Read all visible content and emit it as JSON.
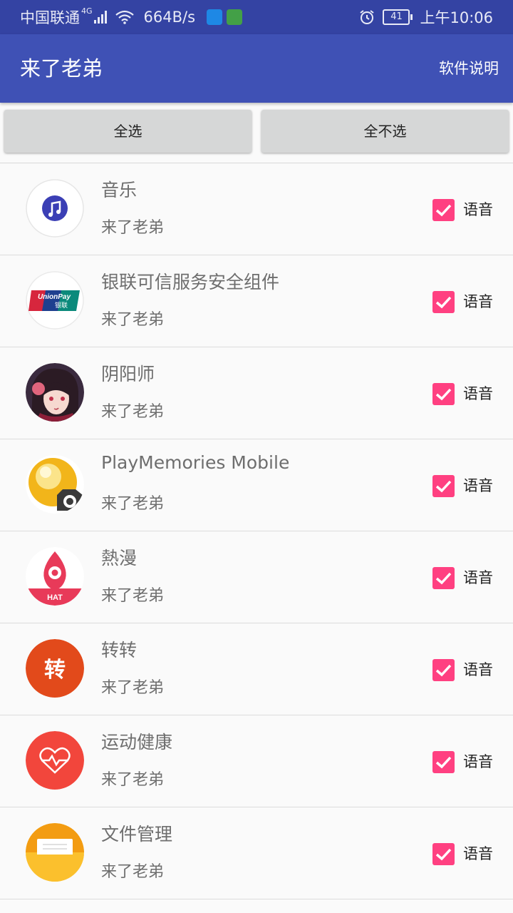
{
  "status_bar": {
    "carrier": "中国联通",
    "network": "4G",
    "speed": "664B/s",
    "battery": "41",
    "time": "上午10:06"
  },
  "app_bar": {
    "title": "来了老弟",
    "action": "软件说明"
  },
  "buttons": {
    "select_all": "全选",
    "select_none": "全不选"
  },
  "items": [
    {
      "name": "音乐",
      "subtitle": "来了老弟",
      "checked": true,
      "check_label": "语音",
      "icon": "music-app-icon"
    },
    {
      "name": "银联可信服务安全组件",
      "subtitle": "来了老弟",
      "checked": true,
      "check_label": "语音",
      "icon": "unionpay-app-icon"
    },
    {
      "name": "阴阳师",
      "subtitle": "来了老弟",
      "checked": true,
      "check_label": "语音",
      "icon": "onmyoji-app-icon"
    },
    {
      "name": "PlayMemories Mobile",
      "subtitle": "来了老弟",
      "checked": true,
      "check_label": "语音",
      "icon": "playmemories-app-icon"
    },
    {
      "name": "熱漫",
      "subtitle": "来了老弟",
      "checked": true,
      "check_label": "语音",
      "icon": "reman-app-icon"
    },
    {
      "name": "转转",
      "subtitle": "来了老弟",
      "checked": true,
      "check_label": "语音",
      "icon": "zhuanzhuan-app-icon"
    },
    {
      "name": "运动健康",
      "subtitle": "来了老弟",
      "checked": true,
      "check_label": "语音",
      "icon": "health-app-icon"
    },
    {
      "name": "文件管理",
      "subtitle": "来了老弟",
      "checked": true,
      "check_label": "语音",
      "icon": "files-app-icon"
    }
  ],
  "colors": {
    "status_bar": "#3443a3",
    "app_bar": "#3f51b5",
    "accent": "#ff4081"
  }
}
